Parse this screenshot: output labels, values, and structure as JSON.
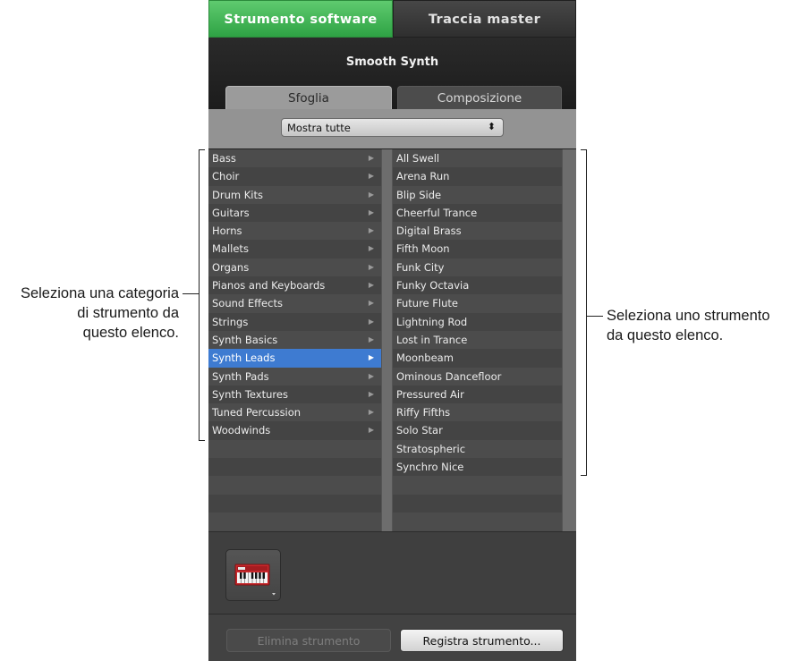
{
  "tabs": {
    "active": "Strumento software",
    "inactive": "Traccia master"
  },
  "instrument_name": "Smooth Synth",
  "subtabs": {
    "active": "Sfoglia",
    "inactive": "Composizione"
  },
  "filter": {
    "value": "Mostra tutte",
    "arrow": "⬍"
  },
  "categories": [
    "Bass",
    "Choir",
    "Drum Kits",
    "Guitars",
    "Horns",
    "Mallets",
    "Organs",
    "Pianos and Keyboards",
    "Sound Effects",
    "Strings",
    "Synth Basics",
    "Synth Leads",
    "Synth Pads",
    "Synth Textures",
    "Tuned Percussion",
    "Woodwinds"
  ],
  "selected_category": "Synth Leads",
  "instruments": [
    "All Swell",
    "Arena Run",
    "Blip Side",
    "Cheerful Trance",
    "Digital Brass",
    "Fifth Moon",
    "Funk City",
    "Funky Octavia",
    "Future Flute",
    "Lightning Rod",
    "Lost in Trance",
    "Moonbeam",
    "Ominous Dancefloor",
    "Pressured Air",
    "Riffy Fifths",
    "Solo Star",
    "Stratospheric",
    "Synchro Nice"
  ],
  "buttons": {
    "delete": "Elimina strumento",
    "save": "Registra strumento..."
  },
  "annotations": {
    "left": [
      "Seleziona una categoria",
      "di strumento da",
      "questo elenco."
    ],
    "right": [
      "Seleziona uno strumento",
      "da questo elenco."
    ]
  },
  "icons": {
    "instrument": "keyboard-icon",
    "popup": "popup-arrows-icon",
    "row_arrow": "disclosure-arrow-icon"
  },
  "colors": {
    "active_tab": "#3fb454",
    "selection": "#3e7bd1"
  }
}
